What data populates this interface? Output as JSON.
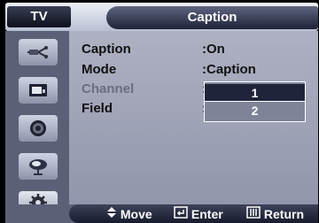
{
  "header": {
    "source_label": "TV",
    "title": "Caption"
  },
  "sidebar": {
    "icons": [
      {
        "name": "input-icon",
        "active": false
      },
      {
        "name": "picture-icon",
        "active": false
      },
      {
        "name": "sound-icon",
        "active": false
      },
      {
        "name": "channel-icon",
        "active": false
      },
      {
        "name": "setup-icon",
        "active": true
      }
    ]
  },
  "menu": {
    "items": [
      {
        "label": "Caption",
        "value": ":On",
        "enabled": true
      },
      {
        "label": "Mode",
        "value": ":Caption",
        "enabled": true
      },
      {
        "label": "Channel",
        "value": ":",
        "enabled": false
      },
      {
        "label": "Field",
        "value": ":",
        "enabled": true
      }
    ]
  },
  "dropdown": {
    "options": [
      "1",
      "2"
    ],
    "selected": "1"
  },
  "help_bar": {
    "move_label": "Move",
    "enter_label": "Enter",
    "return_label": "Return"
  }
}
